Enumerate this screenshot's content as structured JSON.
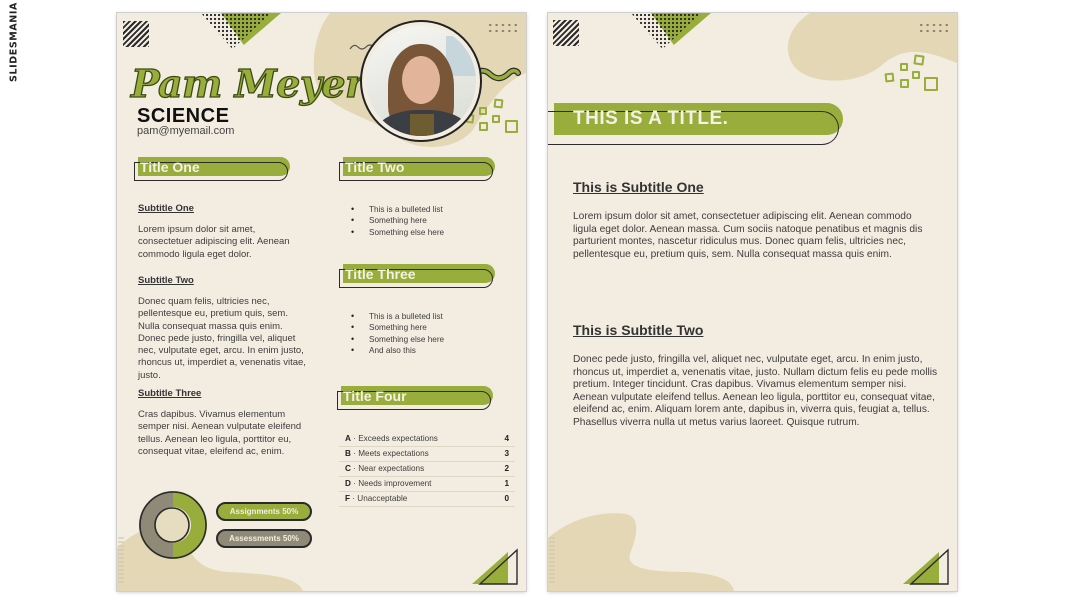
{
  "brand": {
    "text": "SLIDESMANIA"
  },
  "page1": {
    "name": "Pam Meyer",
    "subject": "SCIENCE",
    "email": "pam@myemail.com",
    "photo_alt": "Portrait of Pam Meyer",
    "sections": {
      "title_one": "Title One",
      "title_two": "Title Two",
      "title_three": "Title Three",
      "title_four": "Title Four"
    },
    "subtitle_one": "Subtitle One",
    "para_one": "Lorem ipsum dolor sit amet, consectetuer adipiscing elit. Aenean commodo ligula eget dolor.",
    "subtitle_two": "Subtitle Two",
    "para_two": "Donec quam felis, ultricies nec, pellentesque eu, pretium quis, sem. Nulla consequat massa quis enim. Donec pede justo, fringilla vel, aliquet nec, vulputate eget, arcu. In enim justo, rhoncus ut, imperdiet a, venenatis vitae, justo.",
    "subtitle_three": "Subtitle Three",
    "para_three": "Cras dapibus. Vivamus elementum semper nisi. Aenean vulputate eleifend tellus. Aenean leo ligula, porttitor eu, consequat vitae, eleifend ac, enim.",
    "list_two": [
      "This is a bulleted list",
      "Something here",
      "Something else here"
    ],
    "list_three": [
      "This is a bulleted list",
      "Something here",
      "Something else here",
      "And also this"
    ],
    "grades": [
      {
        "letter": "A",
        "desc": " · Exceeds expectations",
        "points": "4"
      },
      {
        "letter": "B",
        "desc": " · Meets expectations",
        "points": "3"
      },
      {
        "letter": "C",
        "desc": " · Near expectations",
        "points": "2"
      },
      {
        "letter": "D",
        "desc": " · Needs improvement",
        "points": "1"
      },
      {
        "letter": "F",
        "desc": " · Unacceptable",
        "points": "0"
      }
    ],
    "weighting": [
      {
        "label": "Assignments 50%",
        "share": 0.5,
        "color": "#98ad3c"
      },
      {
        "label": "Assessments 50%",
        "share": 0.5,
        "color": "#8f8a78"
      }
    ]
  },
  "page2": {
    "title": "THIS IS A TITLE.",
    "subtitle_one": "This is Subtitle One",
    "para_one": "Lorem ipsum dolor sit amet, consectetuer adipiscing elit. Aenean commodo ligula eget dolor. Aenean massa. Cum sociis natoque penatibus et magnis dis parturient montes, nascetur ridiculus mus. Donec quam felis, ultricies nec, pellentesque eu, pretium quis, sem. Nulla consequat massa quis enim.",
    "subtitle_two": "This is Subtitle Two",
    "para_two": "Donec pede justo, fringilla vel, aliquet nec, vulputate eget, arcu. In enim justo, rhoncus ut, imperdiet a, venenatis vitae, justo. Nullam dictum felis eu pede mollis pretium. Integer tincidunt. Cras dapibus. Vivamus elementum semper nisi. Aenean vulputate eleifend tellus. Aenean leo ligula, porttitor eu, consequat vitae, eleifend ac, enim. Aliquam lorem ante, dapibus in, viverra quis, feugiat a, tellus. Phasellus viverra nulla ut metus varius laoreet. Quisque rutrum."
  },
  "colors": {
    "page_bg": "#f3ede1",
    "accent_green": "#98ad3c",
    "blob_tan": "#e3d7b5",
    "gray_segment": "#8f8a78",
    "ink": "#2b2b2b"
  }
}
